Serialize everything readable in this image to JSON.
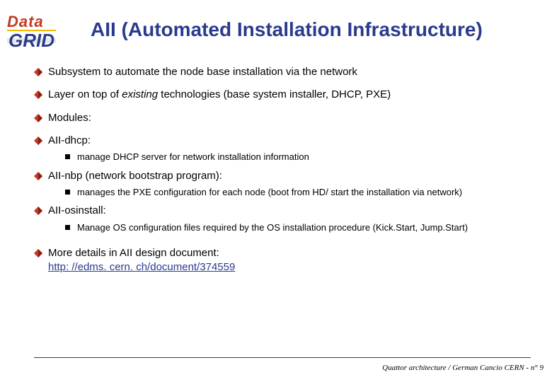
{
  "logo": {
    "top": "Data",
    "bottom": "GRID"
  },
  "title": "AII (Automated Installation Infrastructure)",
  "bullets": [
    {
      "text": "Subsystem to automate the node base installation via the network"
    },
    {
      "pre": "Layer on top of ",
      "italic": "existing",
      "post": " technologies (base system installer, DHCP, PXE)"
    },
    {
      "text": "Modules:"
    },
    {
      "text": "AII-dhcp:",
      "sub": "manage DHCP server for network installation information"
    },
    {
      "text": "AII-nbp (network bootstrap program):",
      "sub": "manages the PXE configuration for each node (boot from HD/ start the installation via network)"
    },
    {
      "text": "AII-osinstall:",
      "sub": "Manage OS configuration files required by the OS installation procedure (Kick.Start, Jump.Start)"
    },
    {
      "text": "More details in AII design document:",
      "link": "http: //edms. cern. ch/document/374559"
    }
  ],
  "footer": "Quattor architecture / German Cancio CERN - n° 9"
}
